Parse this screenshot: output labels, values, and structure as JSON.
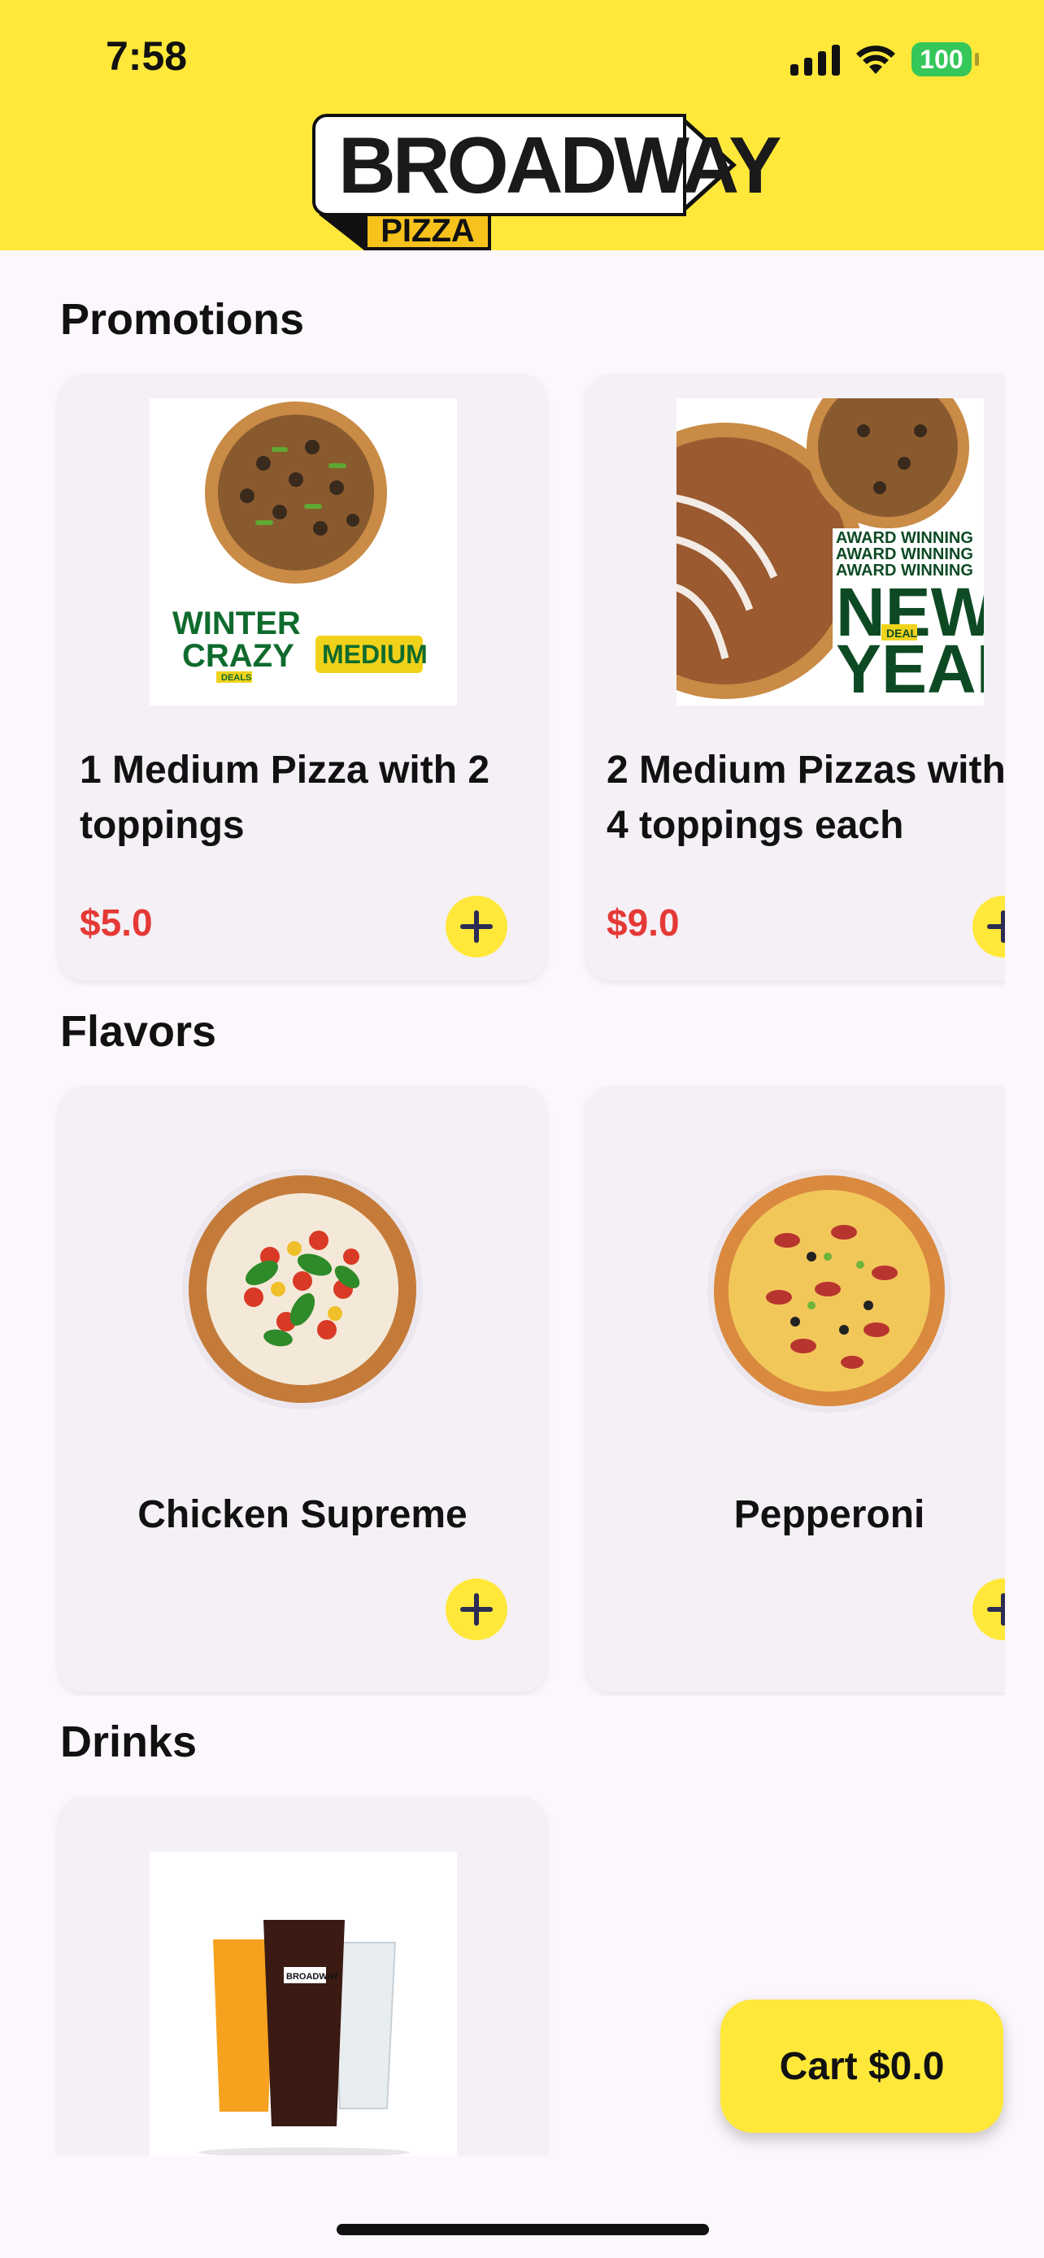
{
  "status_bar": {
    "time": "7:58",
    "battery": "100"
  },
  "brand": {
    "name": "BROADWAY",
    "sub": "PIZZA"
  },
  "sections": {
    "promotions": {
      "title": "Promotions",
      "items": [
        {
          "title_line1": "1 Medium Pizza with 2",
          "title_line2": "toppings",
          "price": "$5.0",
          "image_text": {
            "line1": "WINTER",
            "line2": "CRAZY",
            "badge": "DEALS",
            "size": "MEDIUM"
          }
        },
        {
          "title_line1": "2 Medium Pizzas with",
          "title_line2": "4 toppings each",
          "price": "$9.0",
          "image_text": {
            "line1": "AWARD WINNING",
            "line2": "AWARD WINNING",
            "line3": "AWARD WINNING",
            "big1": "NEW",
            "big2": "YEAR",
            "badge": "DEAL"
          }
        }
      ]
    },
    "flavors": {
      "title": "Flavors",
      "items": [
        {
          "name": "Chicken Supreme"
        },
        {
          "name": "Pepperoni"
        }
      ]
    },
    "drinks": {
      "title": "Drinks",
      "items": [
        {
          "cup_label": "BROADWAY"
        }
      ]
    }
  },
  "cart": {
    "label": "Cart $0.0"
  },
  "colors": {
    "brand_yellow": "#ffe83a",
    "price_red": "#e53935",
    "card_bg": "#f4f0f6",
    "page_bg": "#fcf7fc"
  }
}
